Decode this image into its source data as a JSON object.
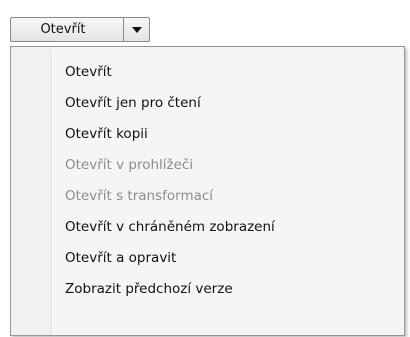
{
  "split_button": {
    "label": "Otevřít",
    "arrow_icon": "chevron-down-icon"
  },
  "menu": {
    "items": [
      {
        "label": "Otevřít",
        "enabled": true
      },
      {
        "label": "Otevřít jen pro čtení",
        "enabled": true
      },
      {
        "label": "Otevřít kopii",
        "enabled": true
      },
      {
        "label": "Otevřít v prohlížeči",
        "enabled": false
      },
      {
        "label": "Otevřít s transformací",
        "enabled": false
      },
      {
        "label": "Otevřít v chráněném zobrazení",
        "enabled": true
      },
      {
        "label": "Otevřít a opravit",
        "enabled": true
      },
      {
        "label": "Zobrazit předchozí verze",
        "enabled": true
      }
    ]
  },
  "colors": {
    "text": "#111111",
    "disabled_text": "#8d8d8d",
    "menu_background": "#f5f5f5",
    "menu_border": "#979797"
  }
}
